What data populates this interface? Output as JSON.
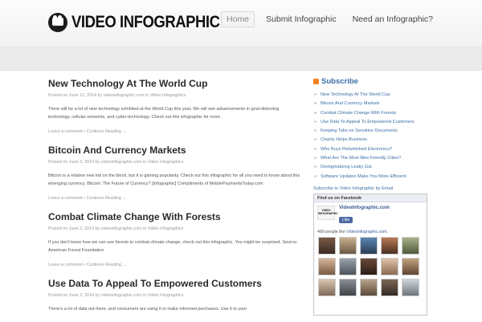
{
  "header": {
    "logo_text": "VIDEO INFOGRAPHIC",
    "nav": [
      {
        "label": "Home",
        "active": true
      },
      {
        "label": "Submit Infographic",
        "active": false
      },
      {
        "label": "Need an Infographic?",
        "active": false
      }
    ]
  },
  "posts": [
    {
      "title": "New Technology At The World Cup",
      "meta_prefix": "Posted on ",
      "date": "June 12, 2014",
      "meta_by": " by ",
      "author": "videoinfographic.com",
      "meta_in": " in ",
      "category": "Video Infographics",
      "excerpt": "There will be a lot of new technology exhibited at the World Cup this year.  We will see advancements in goal-detecting technology, cellular networks, and cyber-technology.  Check out this infographic for more.",
      "comment_link": "Leave a comment",
      "continue_link": "Continue Reading →"
    },
    {
      "title": "Bitcoin And Currency Markets",
      "meta_prefix": "Posted on ",
      "date": "June 3, 2014",
      "meta_by": " by ",
      "author": "videoinfographic.com",
      "meta_in": " in ",
      "category": "Video Infographics",
      "excerpt": "Bitcoin is a relative new kid on the block, but it is gaining popularity.  Check out this infographic for all you need to know about this emerging currency. Bitcoin: The Future of Currency? [Infographic] Compliments of MobilePaymentsToday.com",
      "comment_link": "Leave a comment",
      "continue_link": "Continue Reading →"
    },
    {
      "title": "Combat Climate Change With Forests",
      "meta_prefix": "Posted on ",
      "date": "June 3, 2014",
      "meta_by": " by ",
      "author": "videoinfographic.com",
      "meta_in": " in ",
      "category": "Video Infographics",
      "excerpt": "If you don't know how we can use forests to combat climate change, check out this infographic.  You might be surprised.  Source: American Forest Foundation",
      "comment_link": "Leave a comment",
      "continue_link": "Continue Reading →"
    },
    {
      "title": "Use Data To Appeal To Empowered Customers",
      "meta_prefix": "Posted on ",
      "date": "June 3, 2014",
      "meta_by": " by ",
      "author": "videoinfographic.com",
      "meta_in": " in ",
      "category": "Video Infographics",
      "excerpt": "There's a lot of data out there, and consumers are using it to make informed purchases.  Use it to your",
      "comment_link": "",
      "continue_link": ""
    }
  ],
  "sidebar": {
    "subscribe_title": "Subscribe",
    "links": [
      "New Technology At The World Cup",
      "Bitcoin And Currency Markets",
      "Combat Climate Change With Forests",
      "Use Data To Appeal To Empowered Customers",
      "Keeping Tabs on Sensitive Documents",
      "Charity Helps Business",
      "Who Buys Refurbished Electronics?",
      "What Are The Most Bike Friendly Cities?",
      "Destigmatizing Leaky Gut",
      "Software Updates Make You More Efficient"
    ],
    "email_link": "Subscribe to Video Infographic by Email",
    "facebook": {
      "header": "Find us on Facebook",
      "page_name": "VideoInfographic.com",
      "logo_text": "VIDEO INFOGRAPHIC",
      "like_label": "Like",
      "likes_count": "469",
      "likes_text": " people like ",
      "likes_page": "VideoInfographic.com",
      "likes_end": "."
    }
  },
  "colors": {
    "link_blue": "#3c6fa5",
    "rss_orange": "#f58220",
    "facebook_blue": "#3b5998"
  }
}
